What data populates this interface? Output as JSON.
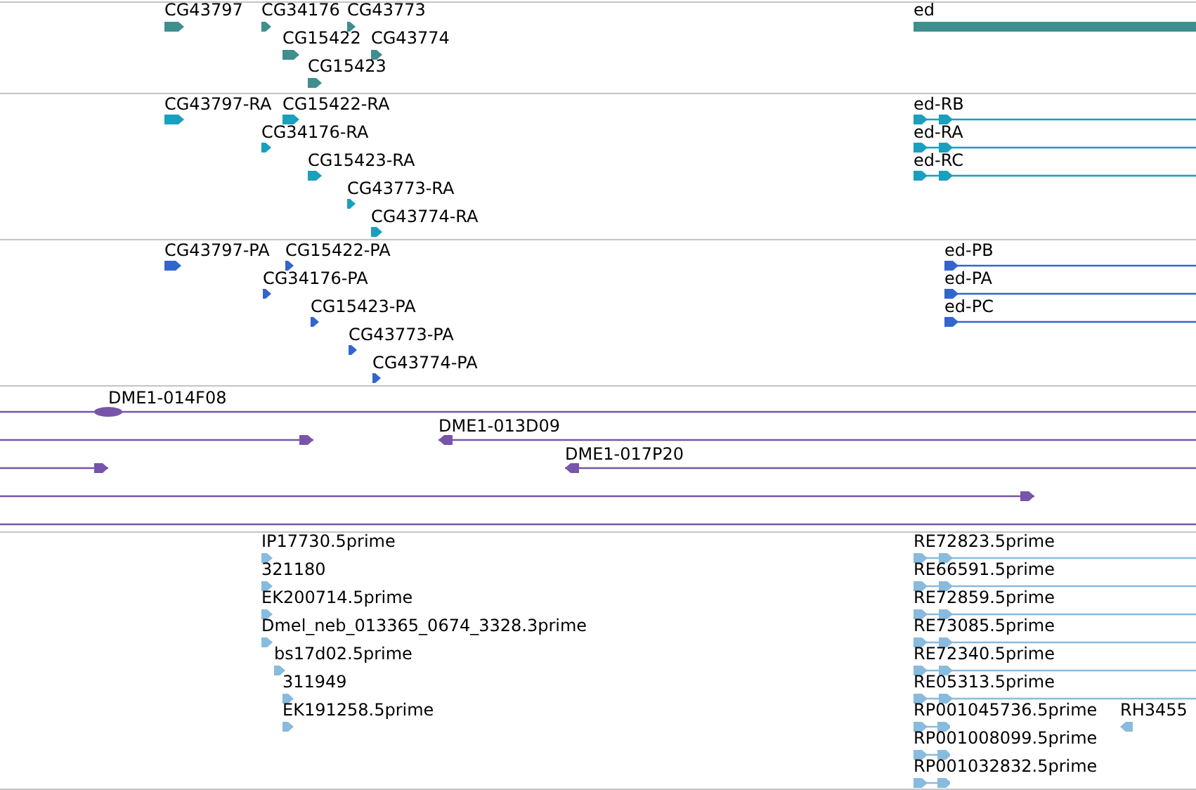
{
  "tracks": [
    {
      "color": "#3f8f8f",
      "features": [
        {
          "label": "CG43797",
          "kind": "block",
          "reverse": false
        },
        {
          "label": "CG34176",
          "kind": "block",
          "reverse": false
        },
        {
          "label": "CG43773",
          "kind": "block",
          "reverse": false
        },
        {
          "label": "ed",
          "kind": "bar"
        },
        {
          "label": "CG15422",
          "kind": "block",
          "reverse": false
        },
        {
          "label": "CG43774",
          "kind": "block",
          "reverse": false
        },
        {
          "label": "CG15423",
          "kind": "block",
          "reverse": false
        }
      ]
    },
    {
      "color": "#1a9fbf",
      "features": [
        {
          "label": "CG43797-RA",
          "kind": "block",
          "reverse": false
        },
        {
          "label": "CG15422-RA",
          "kind": "block",
          "reverse": false
        },
        {
          "label": "ed-RB",
          "kind": "line",
          "reverse": false
        },
        {
          "label": "CG34176-RA",
          "kind": "block",
          "reverse": false
        },
        {
          "label": "ed-RA",
          "kind": "line",
          "reverse": false
        },
        {
          "label": "CG15423-RA",
          "kind": "block",
          "reverse": false
        },
        {
          "label": "ed-RC",
          "kind": "line",
          "reverse": false
        },
        {
          "label": "CG43773-RA",
          "kind": "block",
          "reverse": false
        },
        {
          "label": "CG43774-RA",
          "kind": "block",
          "reverse": false
        }
      ]
    },
    {
      "color": "#3366cc",
      "features": [
        {
          "label": "CG43797-PA",
          "kind": "block",
          "reverse": false
        },
        {
          "label": "CG15422-PA",
          "kind": "block",
          "reverse": false
        },
        {
          "label": "ed-PB",
          "kind": "line",
          "reverse": false
        },
        {
          "label": "CG34176-PA",
          "kind": "block",
          "reverse": false
        },
        {
          "label": "ed-PA",
          "kind": "line",
          "reverse": false
        },
        {
          "label": "CG15423-PA",
          "kind": "block",
          "reverse": false
        },
        {
          "label": "ed-PC",
          "kind": "line",
          "reverse": false
        },
        {
          "label": "CG43773-PA",
          "kind": "block",
          "reverse": false
        },
        {
          "label": "CG43774-PA",
          "kind": "block",
          "reverse": false
        }
      ]
    },
    {
      "color": "#7755aa",
      "features": [
        {
          "label": "DME1-014F08",
          "kind": "paired"
        },
        {
          "kind": "line",
          "reverse": false
        },
        {
          "label": "DME1-013D09",
          "kind": "line",
          "reverse": true
        },
        {
          "kind": "line",
          "reverse": false
        },
        {
          "label": "DME1-017P20",
          "kind": "line",
          "reverse": true
        },
        {
          "kind": "line",
          "reverse": false
        },
        {
          "kind": "line"
        }
      ]
    },
    {
      "color": "#88bbdd",
      "features": [
        {
          "label": "IP17730.5prime",
          "kind": "block",
          "reverse": false
        },
        {
          "label": "RE72823.5prime",
          "kind": "line",
          "reverse": false
        },
        {
          "label": "321180",
          "kind": "block",
          "reverse": false
        },
        {
          "label": "RE66591.5prime",
          "kind": "line",
          "reverse": false
        },
        {
          "label": "EK200714.5prime",
          "kind": "block",
          "reverse": false
        },
        {
          "label": "RE72859.5prime",
          "kind": "line",
          "reverse": false
        },
        {
          "label": "Dmel_neb_013365_0674_3328.3prime",
          "kind": "block",
          "reverse": false
        },
        {
          "label": "RE73085.5prime",
          "kind": "line",
          "reverse": false
        },
        {
          "label": "bs17d02.5prime",
          "kind": "block",
          "reverse": false
        },
        {
          "label": "RE72340.5prime",
          "kind": "line",
          "reverse": false
        },
        {
          "label": "311949",
          "kind": "block",
          "reverse": false
        },
        {
          "label": "RE05313.5prime",
          "kind": "line",
          "reverse": false
        },
        {
          "label": "EK191258.5prime",
          "kind": "block",
          "reverse": false
        },
        {
          "label": "RP001045736.5prime",
          "kind": "line",
          "reverse": false
        },
        {
          "label": "RH3455",
          "kind": "block",
          "reverse": true
        },
        {
          "label": "RP001008099.5prime",
          "kind": "line",
          "reverse": false
        },
        {
          "label": "RP001032832.5prime",
          "kind": "line",
          "reverse": false
        }
      ]
    }
  ]
}
